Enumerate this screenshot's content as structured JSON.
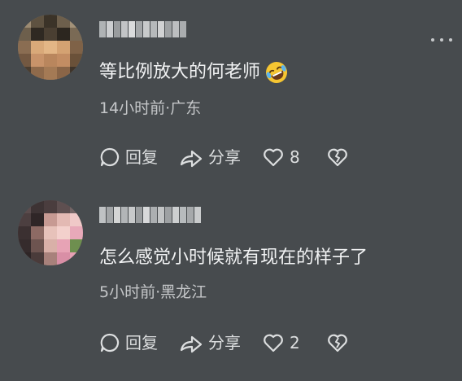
{
  "comments": [
    {
      "content": "等比例放大的何老师",
      "emoji": "rolling-laughing-emoji",
      "time_location": "14小时前·广东",
      "reply_label": "回复",
      "share_label": "分享",
      "like_count": "8"
    },
    {
      "content": "怎么感觉小时候就有现在的样子了",
      "time_location": "5小时前·黑龙江",
      "reply_label": "回复",
      "share_label": "分享",
      "like_count": "2"
    }
  ],
  "icons": {
    "reply": "reply-bubble-icon",
    "share": "share-arrow-icon",
    "like": "heart-icon",
    "dislike": "broken-heart-icon",
    "more": "more-dots-icon"
  },
  "colors": {
    "background": "#474b4e",
    "text_primary": "#f2f3f4",
    "text_secondary": "#c4c6c8",
    "emoji_yellow": "#f6c632"
  }
}
